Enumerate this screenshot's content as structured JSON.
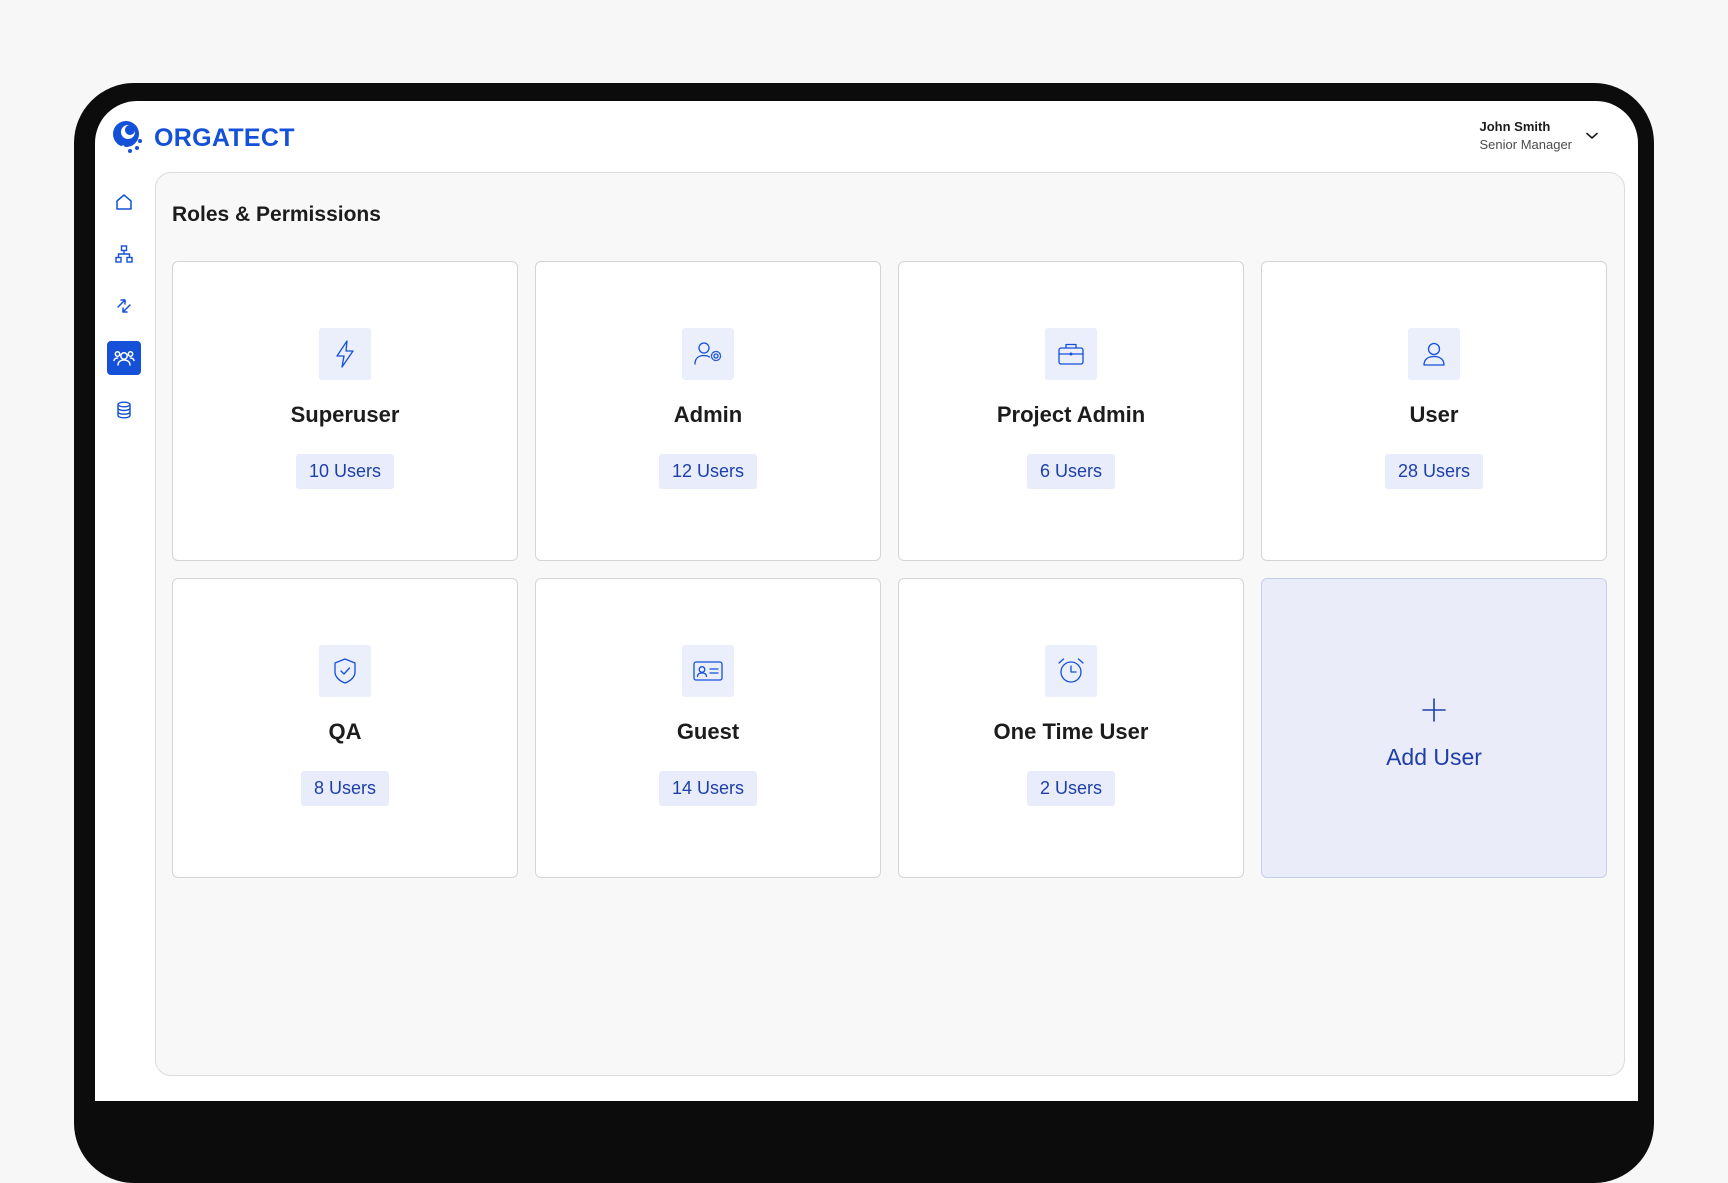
{
  "app": {
    "name": "ORGATECT"
  },
  "user": {
    "name": "John Smith",
    "role": "Senior Manager"
  },
  "sidebar": {
    "items": [
      {
        "icon": "home-icon",
        "active": false
      },
      {
        "icon": "org-chart-icon",
        "active": false
      },
      {
        "icon": "transfer-icon",
        "active": false
      },
      {
        "icon": "users-icon",
        "active": true
      },
      {
        "icon": "database-icon",
        "active": false
      }
    ]
  },
  "page": {
    "title": "Roles & Permissions"
  },
  "roles": [
    {
      "name": "Superuser",
      "count": "10 Users",
      "icon": "lightning-icon"
    },
    {
      "name": "Admin",
      "count": "12 Users",
      "icon": "user-gear-icon"
    },
    {
      "name": "Project Admin",
      "count": "6 Users",
      "icon": "briefcase-icon"
    },
    {
      "name": "User",
      "count": "28 Users",
      "icon": "user-icon"
    },
    {
      "name": "QA",
      "count": "8 Users",
      "icon": "shield-check-icon"
    },
    {
      "name": "Guest",
      "count": "14 Users",
      "icon": "id-card-icon"
    },
    {
      "name": "One Time User",
      "count": "2 Users",
      "icon": "alarm-clock-icon"
    }
  ],
  "add_user": {
    "label": "Add User",
    "icon": "plus-icon"
  },
  "colors": {
    "brand": "#1450d8",
    "badge_bg": "#e8ecfb",
    "badge_text": "#1e3fa8",
    "add_card_bg": "#eaecfa"
  }
}
